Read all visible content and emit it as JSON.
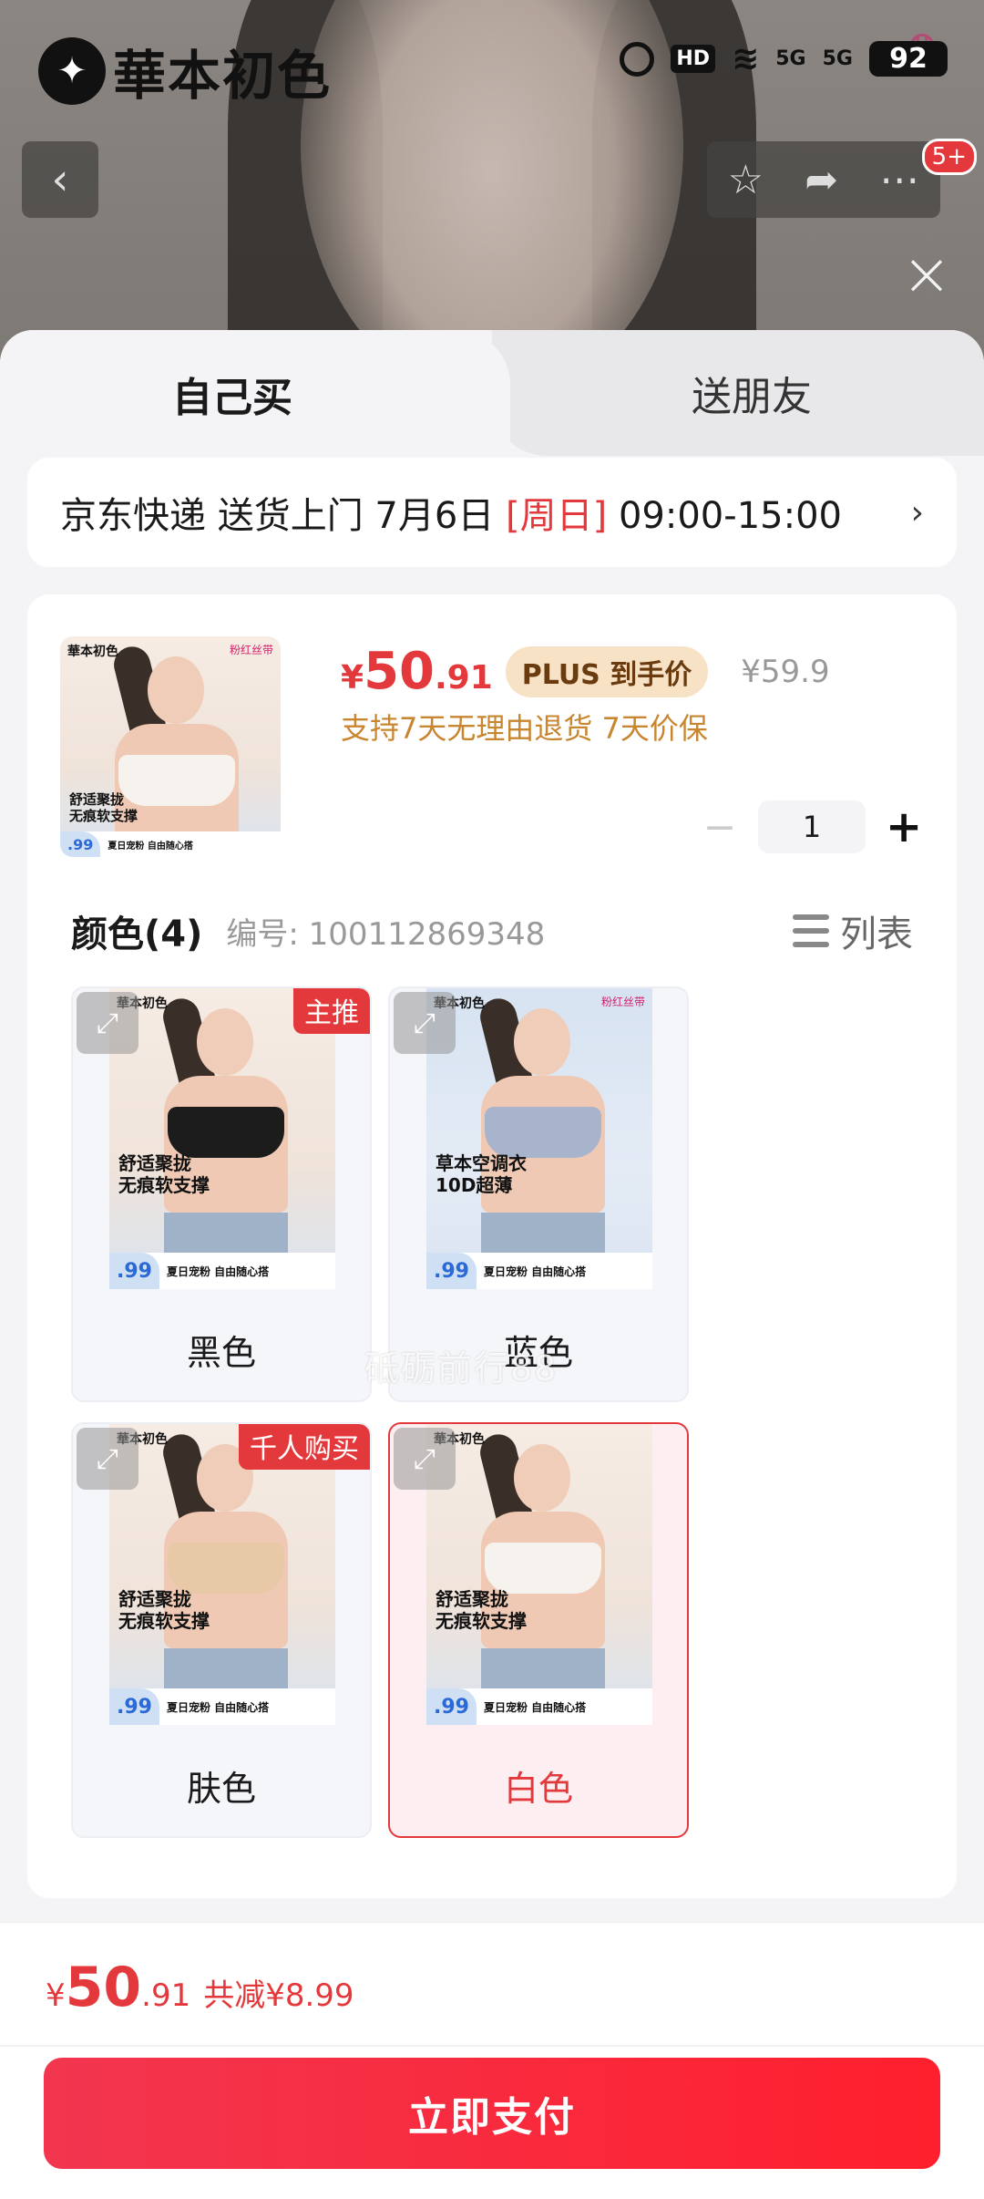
{
  "status_bar": {
    "brand": "華本初色",
    "hd": "HD",
    "net1": "5G",
    "net2": "5G",
    "battery": "92"
  },
  "nav": {
    "back_icon": "chevron-left-icon",
    "badge": "5+"
  },
  "tabs": [
    {
      "label": "自己买"
    },
    {
      "label": "送朋友"
    }
  ],
  "delivery": {
    "prefix": "京东快递 送货上门 7月6日 ",
    "day": "[周日]",
    "time": " 09:00-15:00",
    "chevron": "›"
  },
  "product": {
    "price_symbol": "¥",
    "price_int": "50",
    "price_dec": ".91",
    "plus_badge": "PLUS 到手价",
    "original_price": "¥59.9",
    "service": "支持7天无理由退货  7天价保",
    "quantity": "1"
  },
  "color_section": {
    "title": "颜色(4)",
    "sku": "编号: 100112869348",
    "view_toggle": "列表"
  },
  "options": [
    {
      "label": "黑色",
      "tag": "主推",
      "bra_color": "#1c1c1c",
      "selected": false
    },
    {
      "label": "蓝色",
      "tag": "",
      "bra_color": "#a8b4cc",
      "selected": false
    },
    {
      "label": "肤色",
      "tag": "千人购买",
      "bra_color": "#e7c9a8",
      "selected": false
    },
    {
      "label": "白色",
      "tag": "",
      "bra_color": "#f6f3ef",
      "selected": true
    }
  ],
  "art": {
    "brand": "華本初色",
    "pink": "粉红丝带",
    "copy_line1": "舒适聚拢",
    "copy_line2": "无痕软支撑",
    "blue_copy_line1": "草本空调衣",
    "blue_copy_line2": "10D超薄",
    "price": ".99",
    "promo": "夏日宠粉 自由随心搭"
  },
  "watermark": "砥砺前行88",
  "bottom": {
    "yen": "¥",
    "int": "50",
    "dec": ".91",
    "save": "共减¥8.99",
    "pay_label": "立即支付"
  },
  "colors": {
    "accent_red": "#e4393c",
    "gold": "#c98630"
  }
}
